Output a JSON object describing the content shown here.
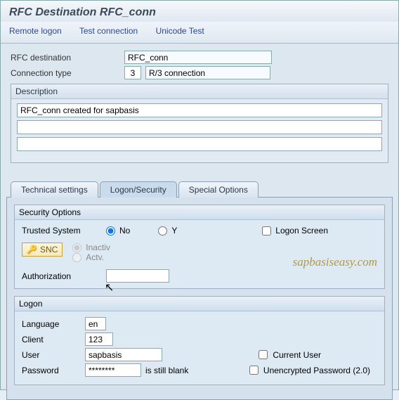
{
  "title": "RFC Destination RFC_conn",
  "menu": {
    "remote_logon": "Remote logon",
    "test_conn": "Test connection",
    "unicode_test": "Unicode Test"
  },
  "info": {
    "rfc_dest_label": "RFC destination",
    "rfc_dest_value": "RFC_conn",
    "conn_type_label": "Connection type",
    "conn_type_code": "3",
    "conn_type_text": "R/3 connection"
  },
  "desc": {
    "title": "Description",
    "line1": "RFC_conn created for sapbasis",
    "line2": "",
    "line3": ""
  },
  "tabs": {
    "technical": "Technical settings",
    "logon_sec": "Logon/Security",
    "special": "Special Options"
  },
  "security": {
    "title": "Security Options",
    "trusted_label": "Trusted System",
    "opt_no": "No",
    "opt_y": "Y",
    "logon_screen": "Logon Screen",
    "snc_label": "SNC",
    "inactiv": "Inactiv",
    "actv": "Actv.",
    "auth_label": "Authorization",
    "auth_value": ""
  },
  "logon": {
    "title": "Logon",
    "language_label": "Language",
    "language_value": "en",
    "client_label": "Client",
    "client_value": "123",
    "user_label": "User",
    "user_value": "sapbasis",
    "password_label": "Password",
    "password_value": "********",
    "pw_hint": "is still blank",
    "current_user": "Current User",
    "unencrypted": "Unencrypted Password (2.0)"
  },
  "watermark": "sapbasiseasy.com"
}
